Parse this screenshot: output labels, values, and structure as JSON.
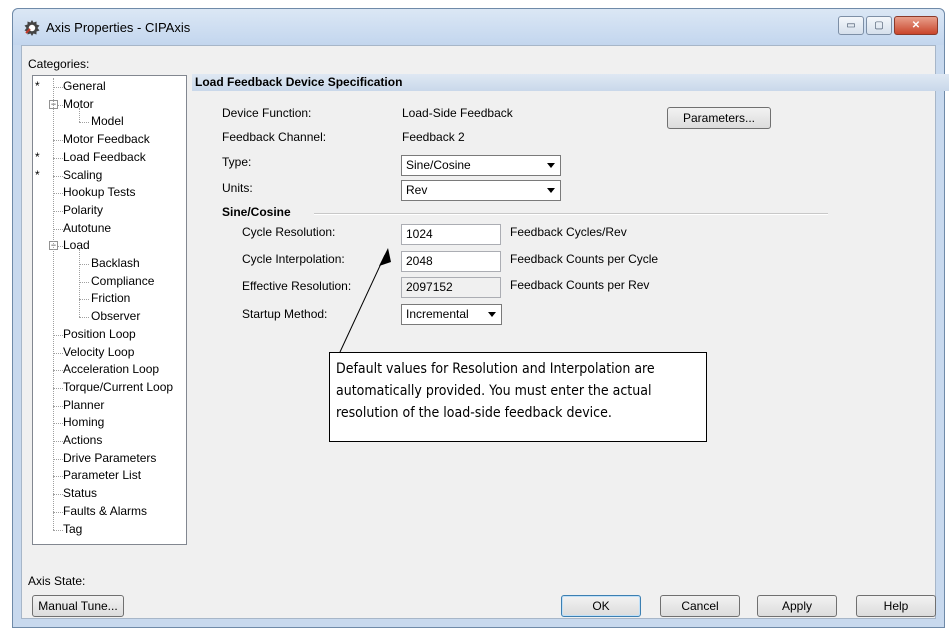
{
  "window": {
    "title": "Axis Properties - CIPAxis",
    "buttons": {
      "minimize": "▭",
      "maximize": "▢",
      "close": "✕"
    }
  },
  "categories": {
    "label": "Categories:",
    "items": [
      {
        "label": "General",
        "star": "*"
      },
      {
        "label": "Motor",
        "expander": "−"
      },
      {
        "label": "Model"
      },
      {
        "label": "Motor Feedback"
      },
      {
        "label": "Load Feedback",
        "star": "*"
      },
      {
        "label": "Scaling",
        "star": "*"
      },
      {
        "label": "Hookup Tests"
      },
      {
        "label": "Polarity"
      },
      {
        "label": "Autotune"
      },
      {
        "label": "Load",
        "expander": "−"
      },
      {
        "label": "Backlash"
      },
      {
        "label": "Compliance"
      },
      {
        "label": "Friction"
      },
      {
        "label": "Observer"
      },
      {
        "label": "Position Loop"
      },
      {
        "label": "Velocity Loop"
      },
      {
        "label": "Acceleration Loop"
      },
      {
        "label": "Torque/Current Loop"
      },
      {
        "label": "Planner"
      },
      {
        "label": "Homing"
      },
      {
        "label": "Actions"
      },
      {
        "label": "Drive Parameters"
      },
      {
        "label": "Parameter List"
      },
      {
        "label": "Status"
      },
      {
        "label": "Faults & Alarms"
      },
      {
        "label": "Tag"
      }
    ]
  },
  "panel": {
    "header": "Load Feedback Device Specification",
    "device_function": {
      "label": "Device Function:",
      "value": "Load-Side Feedback"
    },
    "feedback_channel": {
      "label": "Feedback Channel:",
      "value": "Feedback 2"
    },
    "type": {
      "label": "Type:",
      "value": "Sine/Cosine"
    },
    "units": {
      "label": "Units:",
      "value": "Rev"
    },
    "parameters_button": "Parameters...",
    "section": "Sine/Cosine",
    "cycle_resolution": {
      "label": "Cycle Resolution:",
      "value": "1024",
      "unit": "Feedback Cycles/Rev"
    },
    "cycle_interpolation": {
      "label": "Cycle Interpolation:",
      "value": "2048",
      "unit": "Feedback Counts per Cycle"
    },
    "effective_resolution": {
      "label": "Effective Resolution:",
      "value": "2097152",
      "unit": "Feedback Counts per Rev"
    },
    "startup_method": {
      "label": "Startup Method:",
      "value": "Incremental"
    }
  },
  "callout": {
    "lines": [
      "Default values for Resolution and Interpolation are",
      "automatically provided. You must enter the actual",
      "resolution of the load-side feedback device."
    ]
  },
  "footer": {
    "axis_state_label": "Axis State:",
    "manual_tune": "Manual Tune...",
    "ok": "OK",
    "cancel": "Cancel",
    "apply": "Apply",
    "help": "Help"
  }
}
